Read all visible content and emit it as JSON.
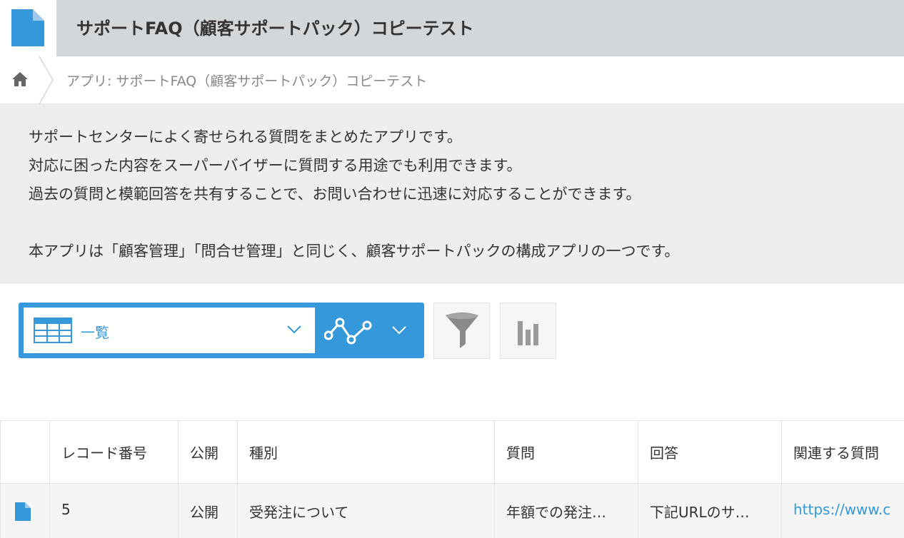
{
  "header": {
    "app_title": "サポートFAQ（顧客サポートパック）コピーテスト"
  },
  "breadcrumb": {
    "text": "アプリ: サポートFAQ（顧客サポートパック）コピーテスト"
  },
  "description": {
    "lines": [
      "サポートセンターによく寄せられる質問をまとめたアプリです。",
      "対応に困った内容をスーパーバイザーに質問する用途でも利用できます。",
      "過去の質問と模範回答を共有することで、お問い合わせに迅速に対応することができます。",
      "本アプリは「顧客管理」「問合せ管理」と同じく、顧客サポートパックの構成アプリの一つです。"
    ]
  },
  "view": {
    "selected": "一覧"
  },
  "table": {
    "headers": [
      "レコード番号",
      "公開",
      "種別",
      "質問",
      "回答",
      "関連する質問"
    ],
    "rows": [
      [
        "5",
        "公開",
        "受発注について",
        "年額での発注…",
        "下記URLのサ…",
        "https://www.c"
      ]
    ]
  },
  "colors": {
    "accent": "#3498db",
    "title_bar": "#d4d7d9",
    "description_bg": "#eeeeee"
  }
}
